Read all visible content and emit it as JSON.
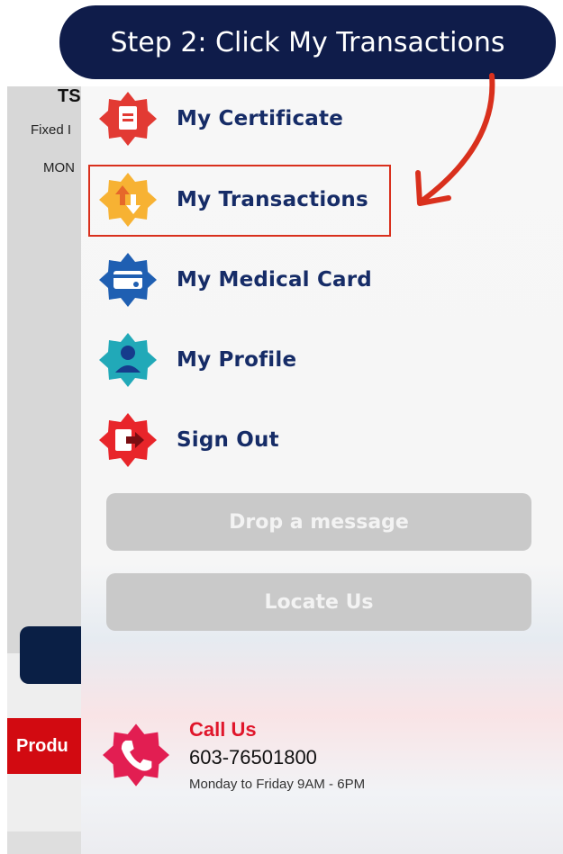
{
  "banner": {
    "text": "Step 2: Click My Transactions"
  },
  "background_app": {
    "title_fragment": "TS",
    "subtitle_fragment": "Fixed I",
    "label_fragment": "MON",
    "product_fragment": "Produ"
  },
  "drawer": {
    "items": [
      {
        "label": "My Certificate",
        "icon": "certificate-icon",
        "color": "#e23a33"
      },
      {
        "label": "My Transactions",
        "icon": "transactions-icon",
        "color": "#f7b233"
      },
      {
        "label": "My Medical Card",
        "icon": "medical-card-icon",
        "color": "#1f5fb2"
      },
      {
        "label": "My Profile",
        "icon": "profile-icon",
        "color": "#21a9b8"
      },
      {
        "label": "Sign Out",
        "icon": "sign-out-icon",
        "color": "#e8252a"
      }
    ],
    "buttons": {
      "drop_message": "Drop a message",
      "locate_us": "Locate Us"
    },
    "contact": {
      "title": "Call Us",
      "phone": "603-76501800",
      "hours": "Monday to Friday 9AM - 6PM"
    }
  },
  "colors": {
    "banner_bg": "#0f1c4a",
    "menu_text": "#162c67",
    "highlight": "#d9301d",
    "call_accent": "#e0162b"
  }
}
